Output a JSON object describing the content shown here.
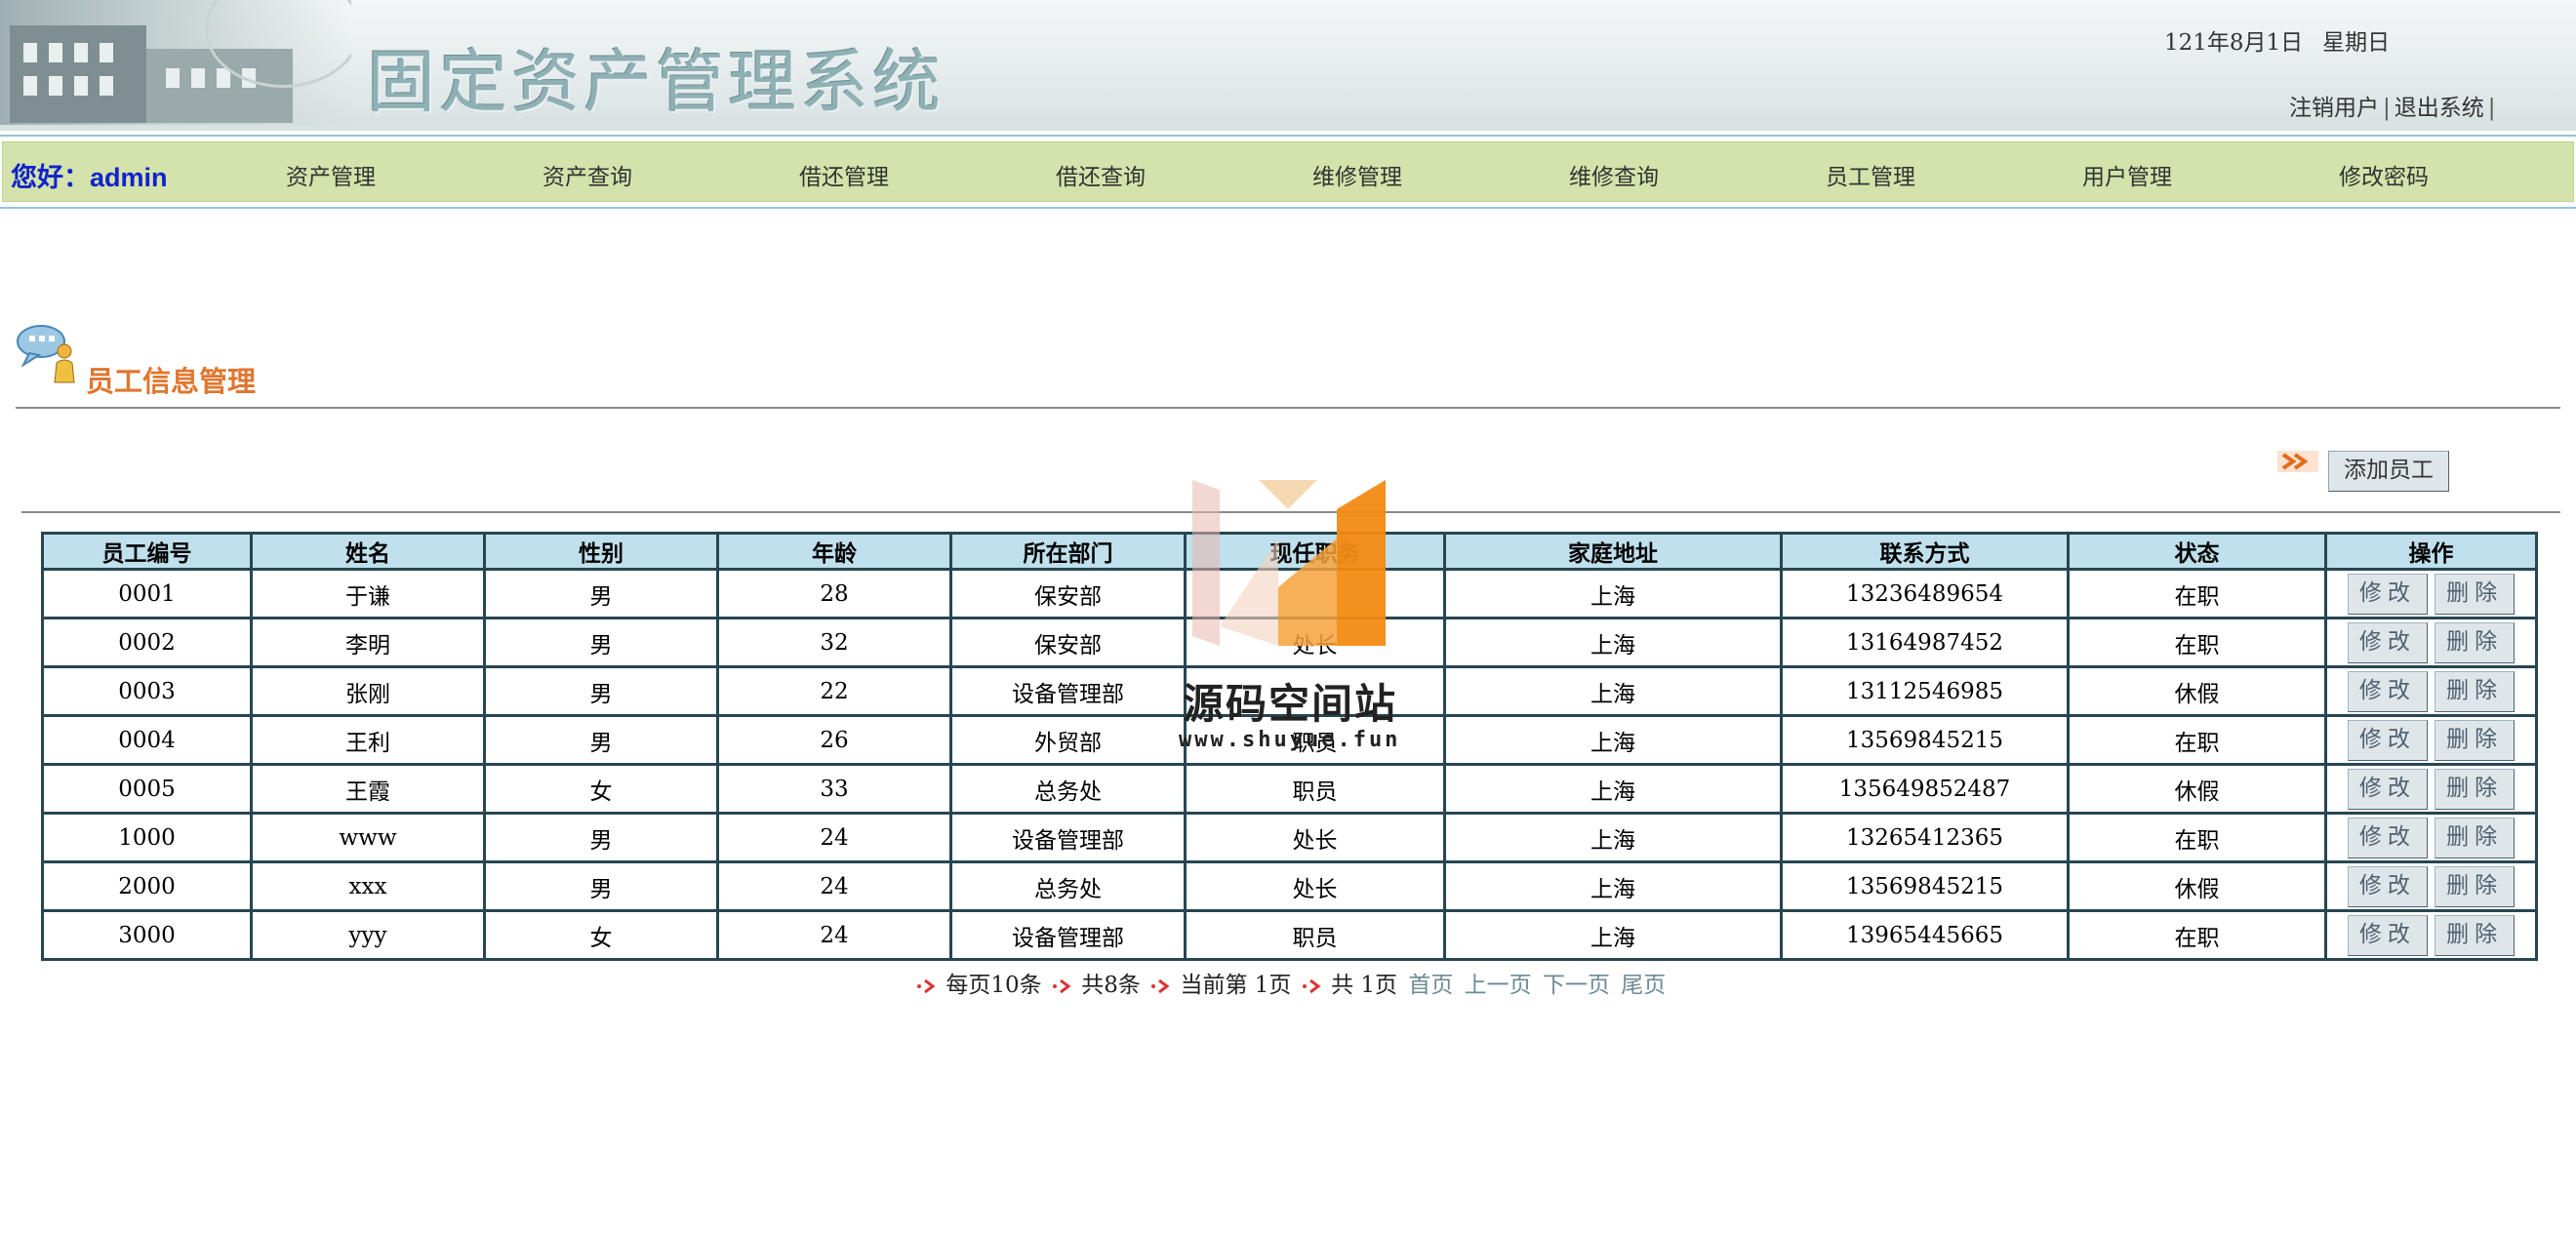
{
  "header": {
    "system_title": "固定资产管理系统",
    "date": "121年8月1日",
    "weekday": "星期日",
    "logout_user": "注销用户",
    "exit_system": "退出系统",
    "separator": "|"
  },
  "nav": {
    "greeting": "您好：admin",
    "items": [
      {
        "label": "资产管理"
      },
      {
        "label": "资产查询"
      },
      {
        "label": "借还管理"
      },
      {
        "label": "借还查询"
      },
      {
        "label": "维修管理"
      },
      {
        "label": "维修查询"
      },
      {
        "label": "员工管理"
      },
      {
        "label": "用户管理"
      },
      {
        "label": "修改密码"
      }
    ]
  },
  "section": {
    "title": "员工信息管理",
    "add_button": "添加员工"
  },
  "table": {
    "headers": [
      "员工编号",
      "姓名",
      "性别",
      "年龄",
      "所在部门",
      "现任职务",
      "家庭地址",
      "联系方式",
      "状态",
      "操作"
    ],
    "rows": [
      {
        "id": "0001",
        "name": "于谦",
        "gender": "男",
        "age": "28",
        "dept": "保安部",
        "title": "",
        "addr": "上海",
        "phone": "13236489654",
        "status": "在职"
      },
      {
        "id": "0002",
        "name": "李明",
        "gender": "男",
        "age": "32",
        "dept": "保安部",
        "title": "处长",
        "addr": "上海",
        "phone": "13164987452",
        "status": "在职"
      },
      {
        "id": "0003",
        "name": "张刚",
        "gender": "男",
        "age": "22",
        "dept": "设备管理部",
        "title": "",
        "addr": "上海",
        "phone": "13112546985",
        "status": "休假"
      },
      {
        "id": "0004",
        "name": "王利",
        "gender": "男",
        "age": "26",
        "dept": "外贸部",
        "title": "职员",
        "addr": "上海",
        "phone": "13569845215",
        "status": "在职"
      },
      {
        "id": "0005",
        "name": "王霞",
        "gender": "女",
        "age": "33",
        "dept": "总务处",
        "title": "职员",
        "addr": "上海",
        "phone": "135649852487",
        "status": "休假"
      },
      {
        "id": "1000",
        "name": "www",
        "gender": "男",
        "age": "24",
        "dept": "设备管理部",
        "title": "处长",
        "addr": "上海",
        "phone": "13265412365",
        "status": "在职"
      },
      {
        "id": "2000",
        "name": "xxx",
        "gender": "男",
        "age": "24",
        "dept": "总务处",
        "title": "处长",
        "addr": "上海",
        "phone": "13569845215",
        "status": "休假"
      },
      {
        "id": "3000",
        "name": "yyy",
        "gender": "女",
        "age": "24",
        "dept": "设备管理部",
        "title": "职员",
        "addr": "上海",
        "phone": "13965445665",
        "status": "在职"
      }
    ],
    "edit_label": "修改",
    "delete_label": "删除"
  },
  "pager": {
    "per_page": "每页10条",
    "total": "共8条",
    "current": "当前第 1页",
    "pages": "共 1页",
    "first": "首页",
    "prev": "上一页",
    "next": "下一页",
    "last": "尾页"
  },
  "watermark": {
    "name": "源码空间站",
    "url": "www.shuyue.fun"
  },
  "colors": {
    "nav_bg": "#d3e3ab",
    "table_header_bg": "#bfe0ec",
    "table_border": "#274651",
    "section_title": "#e0762f",
    "greeting": "#1122cc",
    "pager_link": "#6d8a96"
  }
}
